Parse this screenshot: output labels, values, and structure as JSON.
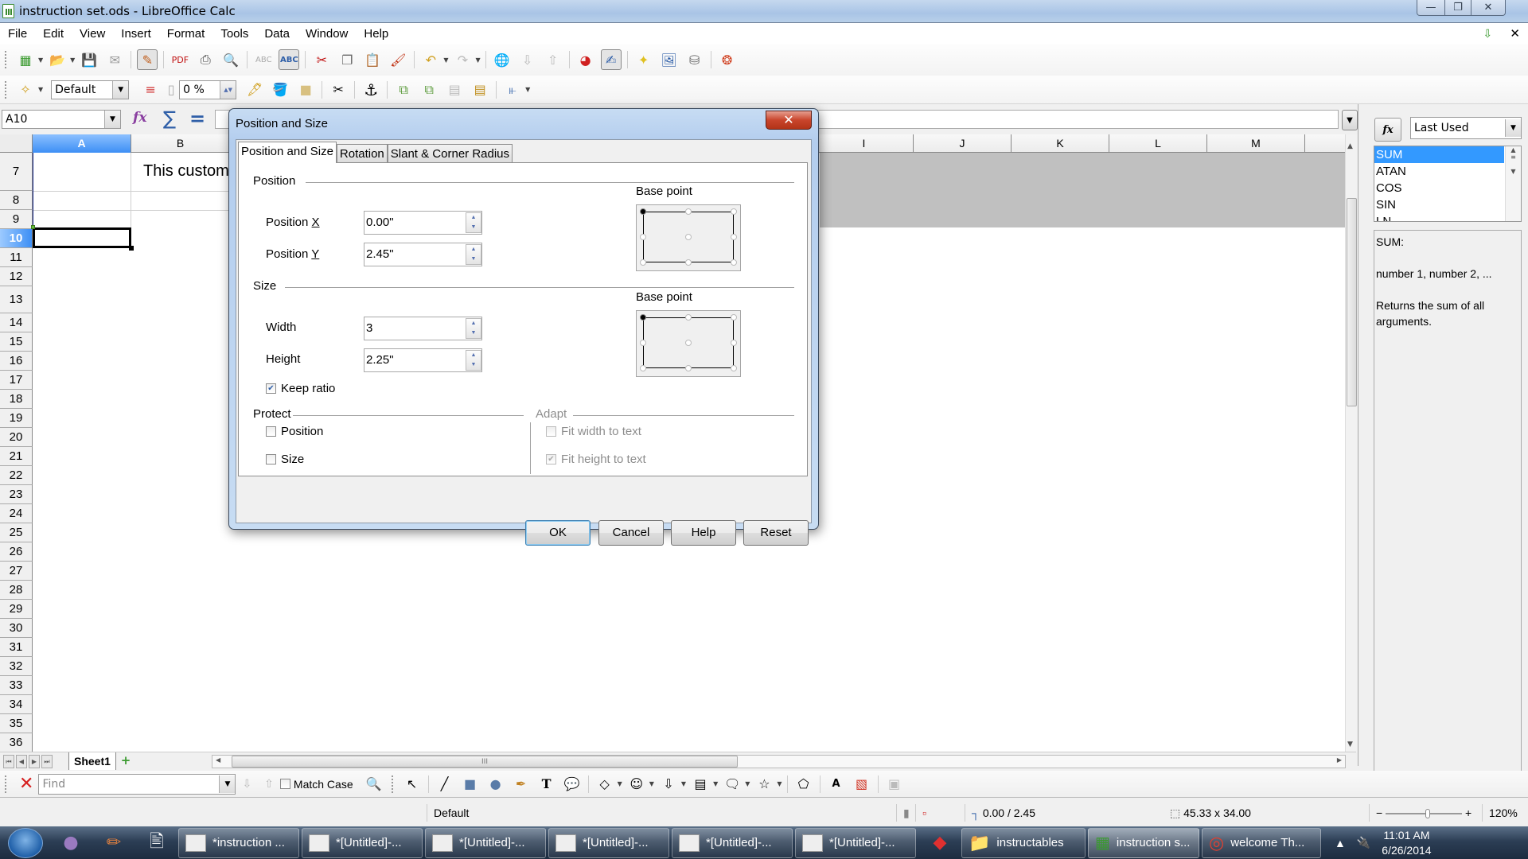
{
  "window": {
    "title": "instruction set.ods - LibreOffice Calc",
    "minimize": "—",
    "maximize": "❐",
    "close": "✕"
  },
  "menu": [
    "File",
    "Edit",
    "View",
    "Insert",
    "Format",
    "Tools",
    "Data",
    "Window",
    "Help"
  ],
  "toolbar2": {
    "style_value": "Default",
    "transparency_value": "0 %"
  },
  "formula_bar": {
    "name_box": "A10",
    "formula": ""
  },
  "grid": {
    "columns": [
      "A",
      "B",
      "I",
      "J",
      "K",
      "L",
      "M"
    ],
    "selected_column": "A",
    "rows": [
      "7",
      "8",
      "9",
      "10",
      "11",
      "12",
      "13",
      "14",
      "15",
      "16",
      "17",
      "18",
      "19",
      "20",
      "21",
      "22",
      "23",
      "24",
      "25",
      "26",
      "27",
      "28",
      "29",
      "30",
      "31",
      "32",
      "33",
      "34",
      "35",
      "36"
    ],
    "selected_row": "10",
    "cell_b7_text": "This custom"
  },
  "sheet_tabs": {
    "tabs": [
      "Sheet1"
    ],
    "add_label": "+"
  },
  "find_bar": {
    "placeholder": "Find",
    "match_case_label": "Match Case",
    "match_case_checked": false
  },
  "status_bar": {
    "page_style": "Default",
    "position": "0.00 / 2.45",
    "size": "45.33 x 34.00",
    "zoom": "120%",
    "zoom_minus": "−",
    "zoom_plus": "+"
  },
  "sidebar": {
    "fx_label": "fx",
    "category": "Last Used",
    "functions": [
      "SUM",
      "ATAN",
      "COS",
      "SIN",
      "LN"
    ],
    "selected_function": "SUM",
    "description_name": "SUM:",
    "description_args": "number 1, number 2, ...",
    "description_text": "Returns the sum of all arguments."
  },
  "dialog": {
    "title": "Position and Size",
    "close_label": "✕",
    "tabs": [
      "Position and Size",
      "Rotation",
      "Slant & Corner Radius"
    ],
    "active_tab": "Position and Size",
    "position": {
      "heading": "Position",
      "x_label": "Position X",
      "x_value": "0.00\"",
      "y_label": "Position Y",
      "y_value": "2.45\"",
      "base_point_label": "Base point",
      "base_point_selected": "top-left"
    },
    "size": {
      "heading": "Size",
      "width_label": "Width",
      "width_value": "3",
      "height_label": "Height",
      "height_value": "2.25\"",
      "keep_ratio_label": "Keep ratio",
      "keep_ratio_checked": true,
      "base_point_label": "Base point",
      "base_point_selected": "top-left"
    },
    "protect": {
      "heading": "Protect",
      "position_label": "Position",
      "position_checked": false,
      "size_label": "Size",
      "size_checked": false
    },
    "adapt": {
      "heading": "Adapt",
      "fit_width_label": "Fit width to text",
      "fit_width_checked": false,
      "fit_height_label": "Fit height to text",
      "fit_height_checked": true,
      "enabled": false
    },
    "buttons": {
      "ok": "OK",
      "cancel": "Cancel",
      "help": "Help",
      "reset": "Reset"
    }
  },
  "taskbar": {
    "tasks": [
      "*instruction ...",
      "*[Untitled]-...",
      "*[Untitled]-...",
      "*[Untitled]-...",
      "*[Untitled]-...",
      "*[Untitled]-...",
      "instructables",
      "instruction s...",
      "welcome Th..."
    ],
    "time": "11:01 AM",
    "date": "6/26/2014"
  }
}
